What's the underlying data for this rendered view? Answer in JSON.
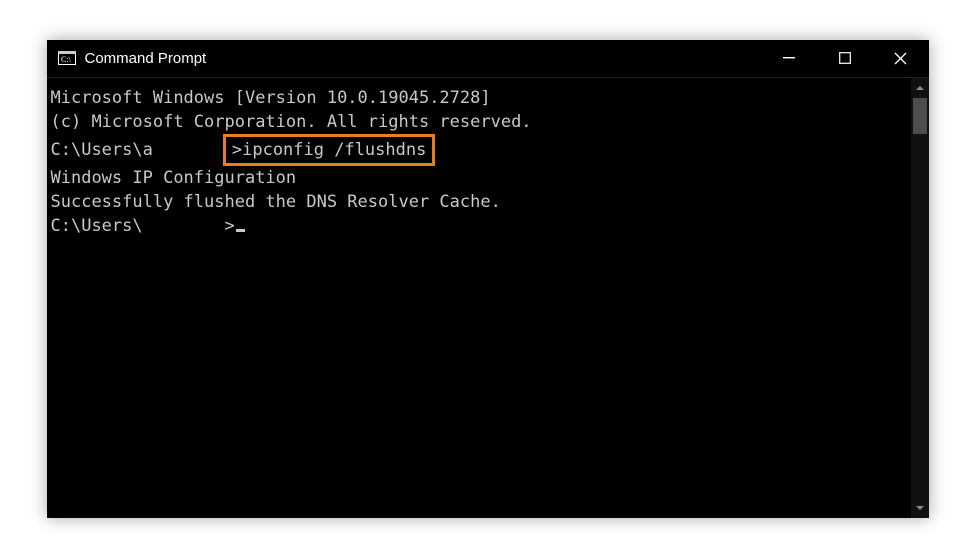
{
  "window": {
    "title": "Command Prompt"
  },
  "terminal": {
    "banner1": "Microsoft Windows [Version 10.0.19045.2728]",
    "banner2": "(c) Microsoft Corporation. All rights reserved.",
    "blank": "",
    "prompt1_path": "C:\\Users\\a",
    "prompt1_gap": "       ",
    "prompt1_marker": ">",
    "prompt1_command": "ipconfig /flushdns",
    "output_header": "Windows IP Configuration",
    "output_result": "Successfully flushed the DNS Resolver Cache.",
    "prompt2_path": "C:\\Users\\",
    "prompt2_gap": "        ",
    "prompt2_marker": ">"
  },
  "colors": {
    "highlight_border": "#e97e1e"
  }
}
